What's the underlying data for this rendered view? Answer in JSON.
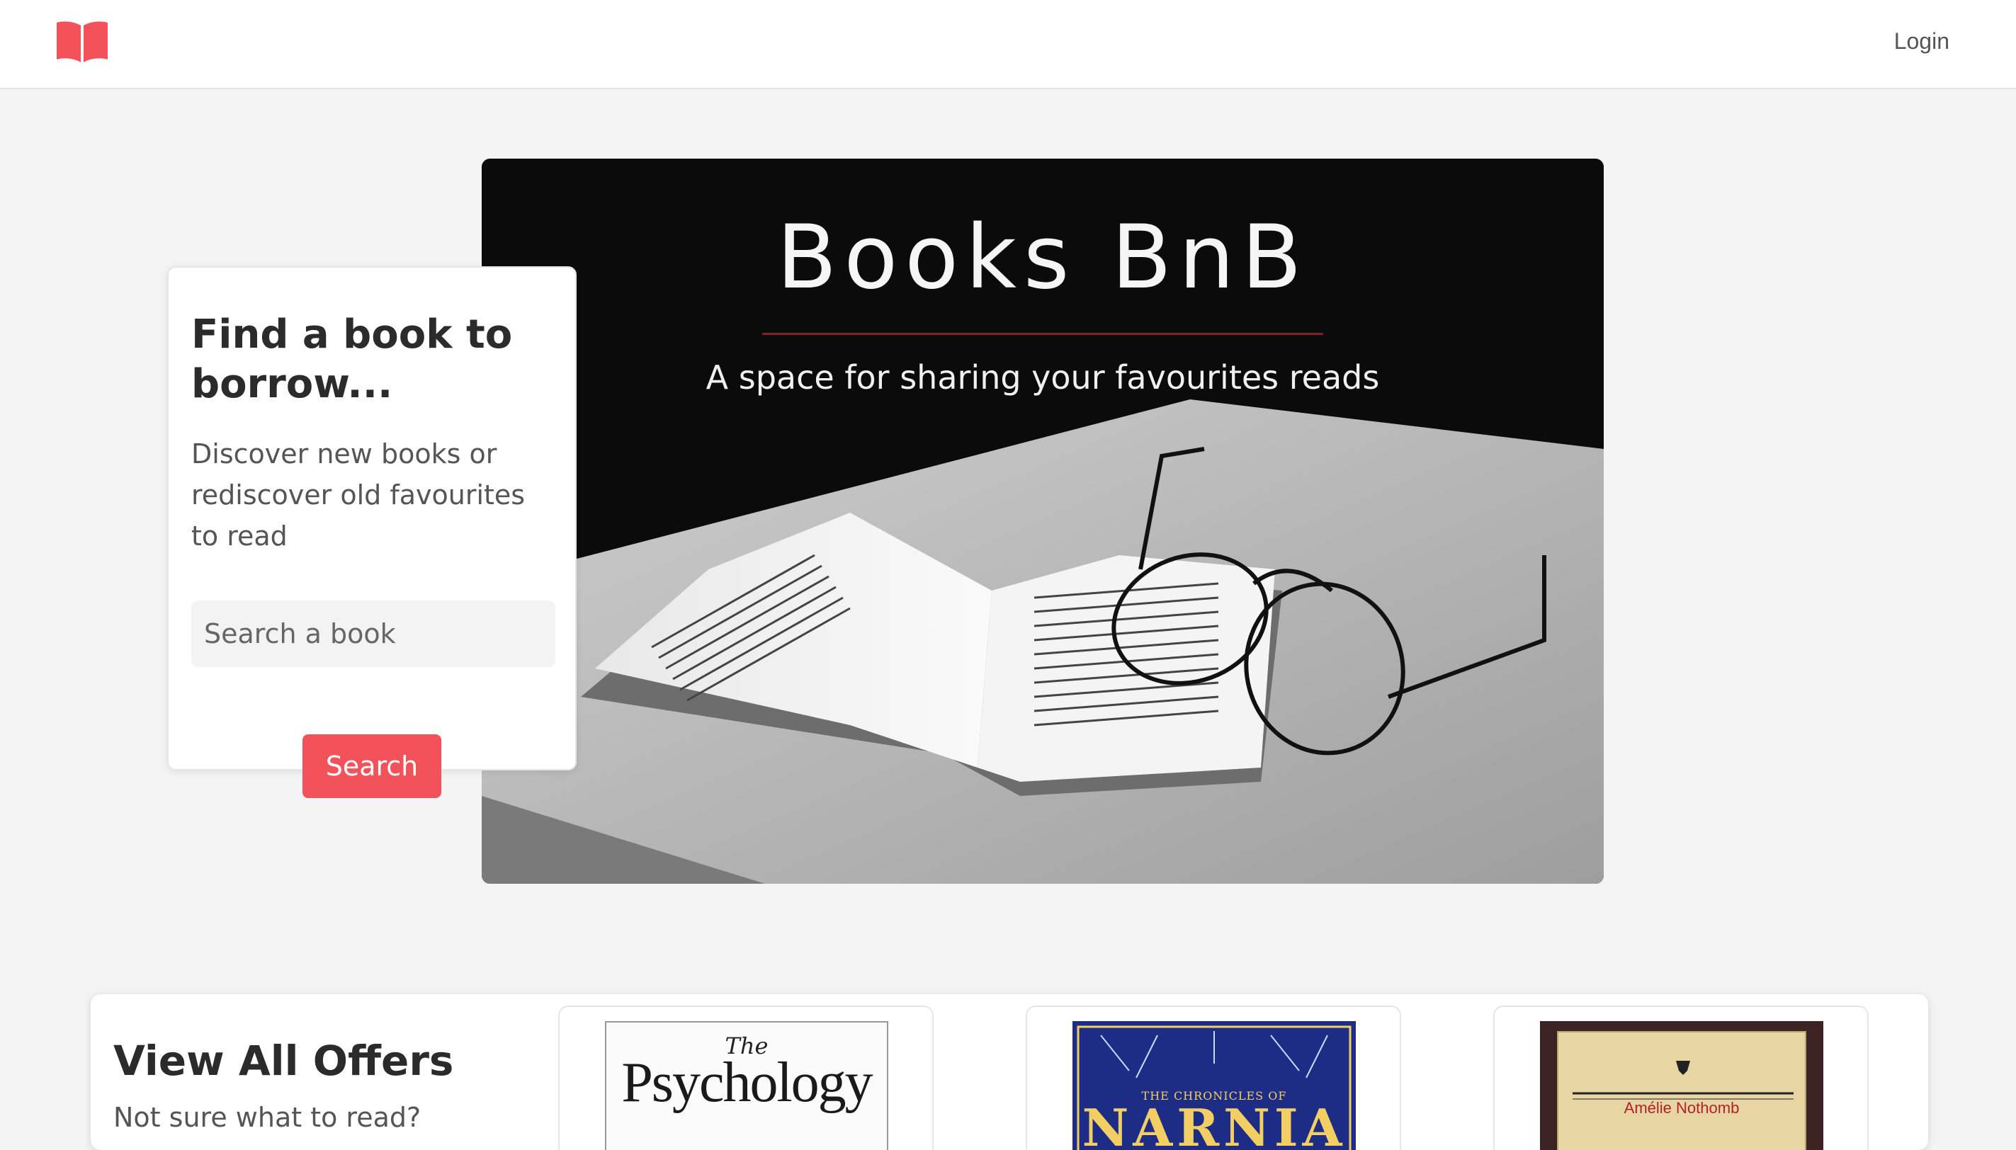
{
  "navbar": {
    "logo_icon": "open-book-icon",
    "login_label": "Login",
    "brand_color": "#f4525a"
  },
  "hero": {
    "title": "Books BnB",
    "subtitle": "A space for sharing your favourites reads",
    "image": "open book with glasses (black and white photo)"
  },
  "search_card": {
    "title": "Find a book to borrow...",
    "description": "Discover new books or rediscover old favourites to read",
    "input_placeholder": "Search a book",
    "button_label": "Search"
  },
  "offers": {
    "title": "View All Offers",
    "subtitle": "Not sure what to read?",
    "books": [
      {
        "cover_the": "The",
        "cover_title": "Psychology"
      },
      {
        "series": "THE CHRONICLES OF",
        "cover_title": "NARNIA"
      },
      {
        "author": "Amélie Nothomb"
      }
    ]
  }
}
